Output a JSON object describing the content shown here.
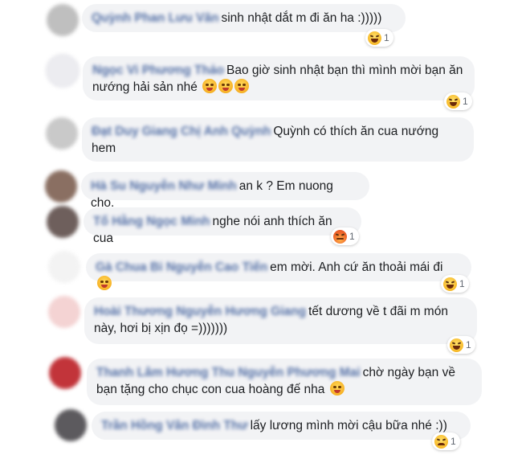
{
  "comments": [
    {
      "name": "Quỳnh Phan Lưu Văn",
      "text": "sinh nhật dắt m đi ăn ha :)))))",
      "avatar_color": "#bfbfbf",
      "reaction": {
        "icon": "laughing-icon",
        "count": "1"
      }
    },
    {
      "name": "Ngọc Vi Phương Thảo",
      "text": "Bao giờ sinh nhật bạn thì mình mời bạn ăn nướng hải sản nhé",
      "avatar_color": "#e9e9ee",
      "emoji": [
        "kiss-icon",
        "kiss-icon",
        "kiss-icon"
      ],
      "reaction": {
        "icon": "laughing-icon",
        "count": "1"
      }
    },
    {
      "name": "Đạt Duy Giang Chị Anh Quỳnh",
      "text": "Quỳnh có thích ăn cua nướng hem",
      "avatar_color": "#c9c9c9"
    },
    {
      "name": "Hà Su Nguyễn Như Minh",
      "text": "an k ? Em nuong cho.",
      "avatar_color": "#8a6f62"
    },
    {
      "name": "Tố Hằng Ngọc Minh",
      "text": "nghe nói anh thích ăn cua",
      "avatar_color": "#6e5f5c",
      "reaction": {
        "icon": "angry-icon",
        "count": "1"
      }
    },
    {
      "name": "Gà Chua Bi Nguyễn Cao Tiến",
      "text": "em mời. Anh cứ ăn thoải mái đi",
      "avatar_color": "#f3f3f3",
      "emoji": [
        "relieved-icon"
      ],
      "reaction": {
        "icon": "laughing-icon",
        "count": "1"
      }
    },
    {
      "name": "Hoài Thương Nguyễn Hương Giang",
      "text": "tết dương về t đãi m món này, hơi bị xịn đọ =)))))))",
      "avatar_color": "#f4d3d3",
      "reaction": {
        "icon": "laughing-icon",
        "count": "1"
      }
    },
    {
      "name": "Thanh Lâm Hương Thu Nguyễn Phương Mai",
      "text": "chờ ngày bạn về bạn tặng cho chục con cua hoàng đế nha",
      "avatar_color": "#c2343a",
      "emoji": [
        "triumph-icon"
      ]
    },
    {
      "name": "Trần Hồng Vân Đình Thư",
      "text": "lấy lương mình mời cậu bữa nhé :))",
      "avatar_color": "#5c5a5e",
      "reaction": {
        "icon": "sad-icon",
        "count": "1"
      }
    }
  ]
}
